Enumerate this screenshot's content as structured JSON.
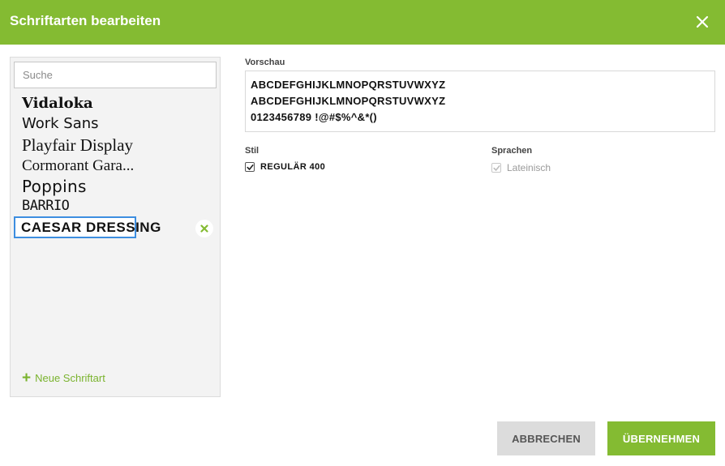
{
  "dialog": {
    "title": "Schriftarten bearbeiten"
  },
  "search": {
    "placeholder": "Suche"
  },
  "fonts": [
    {
      "label": "Vidaloka"
    },
    {
      "label": "Work Sans"
    },
    {
      "label": "Playfair Display"
    },
    {
      "label": "Cormorant Gara..."
    },
    {
      "label": "Poppins"
    },
    {
      "label": "BARRIO"
    },
    {
      "label": "CAESAR DRESSING",
      "selected": true
    }
  ],
  "new_font": {
    "label": "Neue Schriftart"
  },
  "preview": {
    "label": "Vorschau",
    "lines": [
      "ABCDEFGHIJKLMNOPQRSTUVWXYZ",
      "ABCDEFGHIJKLMNOPQRSTUVWXYZ",
      "0123456789 !@#$%^&*()"
    ]
  },
  "style": {
    "label": "Stil",
    "options": [
      {
        "label": "REGULÄR 400",
        "checked": true
      }
    ]
  },
  "languages": {
    "label": "Sprachen",
    "options": [
      {
        "label": "Lateinisch",
        "checked": true,
        "disabled": true
      }
    ]
  },
  "buttons": {
    "cancel": "ABBRECHEN",
    "apply": "ÜBERNEHMEN"
  },
  "colors": {
    "accent": "#84bb32",
    "selection_border": "#3d8ee0",
    "panel_bg": "#f3f3f3"
  },
  "icons": {
    "close": "close-icon",
    "remove": "remove-icon",
    "add": "plus-icon",
    "check": "check-icon"
  }
}
